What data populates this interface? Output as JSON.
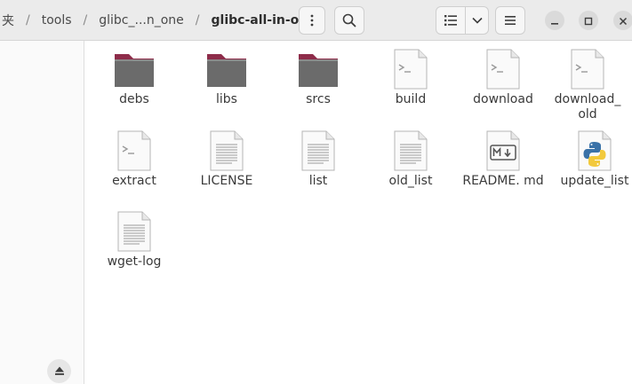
{
  "breadcrumbs": [
    "夹",
    "tools",
    "glibc_...n_one",
    "glibc-all-in-one"
  ],
  "header_icons": {
    "menu": "vertical-dots-icon",
    "search": "search-icon",
    "view": "list-view-icon",
    "view_options": "chevron-down-icon",
    "hamburger": "hamburger-menu-icon",
    "minimize": "minimize-icon",
    "maximize": "maximize-icon",
    "close": "close-icon"
  },
  "sidebar": {
    "eject_icon": "eject-icon"
  },
  "files": [
    {
      "name": "debs",
      "type": "folder"
    },
    {
      "name": "libs",
      "type": "folder"
    },
    {
      "name": "srcs",
      "type": "folder"
    },
    {
      "name": "build",
      "type": "script"
    },
    {
      "name": "download",
      "type": "script"
    },
    {
      "name": "download_ old",
      "type": "script"
    },
    {
      "name": "extract",
      "type": "script"
    },
    {
      "name": "LICENSE",
      "type": "text"
    },
    {
      "name": "list",
      "type": "text"
    },
    {
      "name": "old_list",
      "type": "text"
    },
    {
      "name": "README. md",
      "type": "markdown"
    },
    {
      "name": "update_list",
      "type": "python"
    },
    {
      "name": "wget-log",
      "type": "text"
    }
  ],
  "colors": {
    "folder_body": "#6b6b6b",
    "folder_tab": "#8e2c4a",
    "header_bg": "#ebebeb",
    "sidebar_bg": "#fafafa"
  }
}
